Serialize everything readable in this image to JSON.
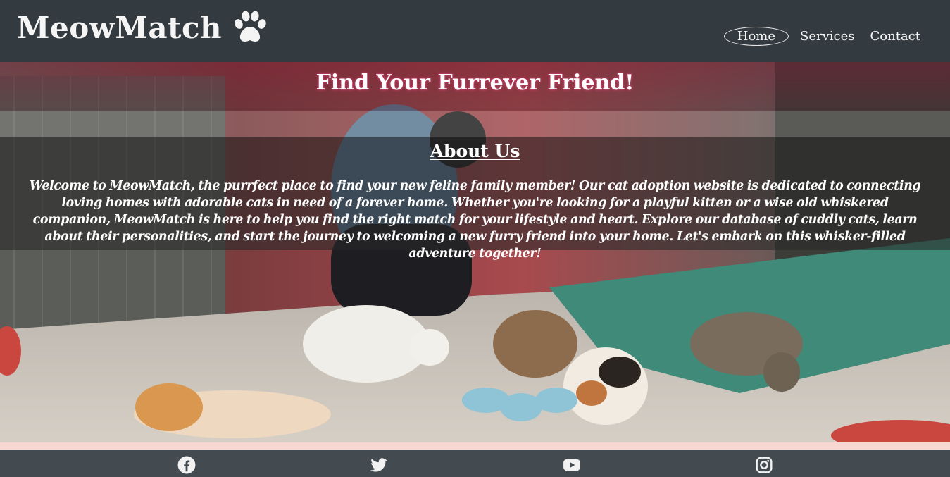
{
  "header": {
    "brand": "MeowMatch",
    "brand_icon": "paw-icon",
    "nav": [
      {
        "label": "Home",
        "active": true
      },
      {
        "label": "Services",
        "active": false
      },
      {
        "label": "Contact",
        "active": false
      }
    ]
  },
  "hero": {
    "title": "Find Your Furrever Friend!",
    "background": "photo of a person feeding cats at a shelter"
  },
  "about": {
    "title": "About Us",
    "text": "Welcome to MeowMatch, the purrfect place to find your new feline family member! Our cat adoption website is dedicated to connecting loving homes with adorable cats in need of a forever home. Whether you're looking for a playful kitten or a wise old whiskered companion, MeowMatch is here to help you find the right match for your lifestyle and heart. Explore our database of cuddly cats, learn about their personalities, and start the journey to welcoming a new furry friend into your home. Let's embark on this whisker-filled adventure together!"
  },
  "footer": {
    "social": [
      "facebook-icon",
      "twitter-icon",
      "youtube-icon",
      "instagram-icon"
    ]
  },
  "colors": {
    "header_bg": "#343b40",
    "footer_bg": "#434b50",
    "accent_strip": "#f6d7d2",
    "title_glow": "#d04070"
  }
}
